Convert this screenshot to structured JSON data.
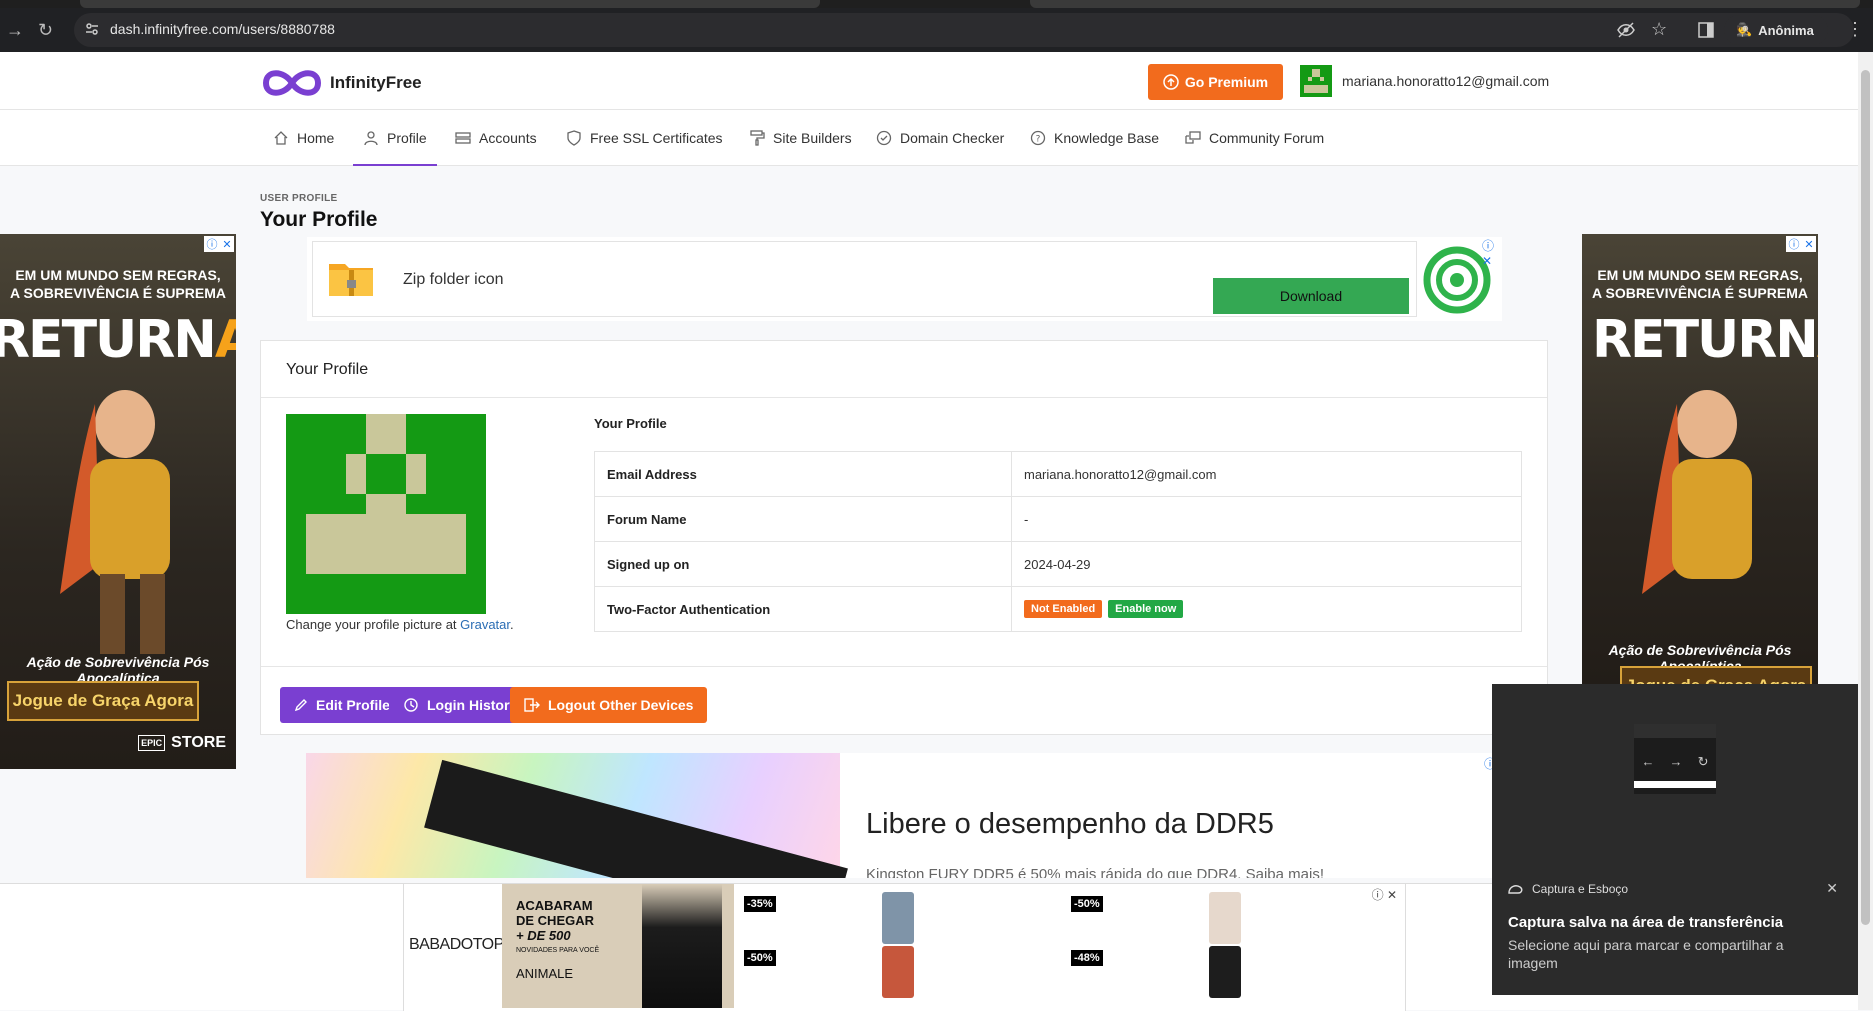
{
  "browser": {
    "url": "dash.infinityfree.com/users/8880788",
    "profile_label": "Anônima"
  },
  "header": {
    "logo_text": "InfinityFree",
    "premium_label": "Go Premium",
    "user_email": "mariana.honoratto12@gmail.com"
  },
  "nav": {
    "items": [
      {
        "label": "Home",
        "icon": "home-icon"
      },
      {
        "label": "Profile",
        "icon": "user-icon"
      },
      {
        "label": "Accounts",
        "icon": "server-icon"
      },
      {
        "label": "Free SSL Certificates",
        "icon": "shield-icon"
      },
      {
        "label": "Site Builders",
        "icon": "paint-roller-icon"
      },
      {
        "label": "Domain Checker",
        "icon": "check-circle-icon"
      },
      {
        "label": "Knowledge Base",
        "icon": "question-circle-icon"
      },
      {
        "label": "Community Forum",
        "icon": "chat-icon"
      }
    ],
    "active": "Profile"
  },
  "page": {
    "kicker": "USER PROFILE",
    "title": "Your Profile"
  },
  "ad_top": {
    "label": "Zip folder icon",
    "button": "Download"
  },
  "profile_card": {
    "title": "Your Profile",
    "gravatar_text": "Change your profile picture at ",
    "gravatar_link": "Gravatar",
    "gravatar_suffix": ".",
    "details_title": "Your Profile",
    "rows": [
      {
        "key": "Email Address",
        "value": "mariana.honoratto12@gmail.com"
      },
      {
        "key": "Forum Name",
        "value": "-"
      },
      {
        "key": "Signed up on",
        "value": "2024-04-29"
      },
      {
        "key": "Two-Factor Authentication",
        "value": ""
      }
    ],
    "twofa_status": "Not Enabled",
    "twofa_action": "Enable now",
    "buttons": {
      "edit": "Edit Profile",
      "history": "Login History",
      "logout": "Logout Other Devices"
    }
  },
  "side_ad": {
    "headline_1": "EM UM MUNDO SEM REGRAS,",
    "headline_2": "A SOBREVIVÊNCIA É SUPREMA",
    "title_a": "RETURN",
    "title_b": "ALIVE",
    "tagline": "Ação de Sobrevivência Pós Apocalíptica",
    "cta": "Jogue de Graça Agora",
    "store_1": "EPIC",
    "store_2": "STORE"
  },
  "ad_ddr": {
    "headline": "Libere o desempenho da DDR5",
    "sub": "Kingston FURY DDR5 é 50% mais rápida do que DDR4. Saiba mais!"
  },
  "bottom_ad": {
    "brand": "BABADOTOP",
    "promo_line1": "ACABARAM",
    "promo_line2": "DE CHEGAR",
    "promo_line3": "+ DE 500",
    "promo_small": "NOVIDADES PARA VOCÊ",
    "promo_brands": "ANIMALE",
    "discounts": [
      "-35%",
      "-50%",
      "-50%",
      "-48%"
    ]
  },
  "toast": {
    "app": "Captura e Esboço",
    "title": "Captura salva na área de transferência",
    "body": "Selecione aqui para marcar e compartilhar a imagem"
  },
  "colors": {
    "brand_purple": "#7a3fd1",
    "accent_orange": "#f26b1d",
    "success_green": "#22a845"
  }
}
